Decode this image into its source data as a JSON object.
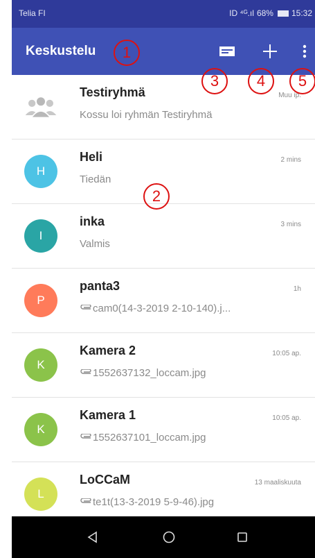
{
  "status_bar": {
    "carrier": "Telia FI",
    "signal_text": "ID ⁴ᴳ.ıl",
    "battery": "68%",
    "time": "15:32"
  },
  "app_bar": {
    "title": "Keskustelu",
    "actions": [
      "message-icon",
      "add-icon",
      "more-vert-icon"
    ]
  },
  "conversations": [
    {
      "name": "Testiryhmä",
      "preview": "Kossu loi ryhmän Testiryhmä",
      "time": "Muu ip.",
      "avatar_letter": "",
      "avatar_color": "#c8c8c8",
      "is_group": true,
      "attachment": false
    },
    {
      "name": "Heli",
      "preview": "Tiedän",
      "time": "2 mins",
      "avatar_letter": "H",
      "avatar_color": "#4dc3e5",
      "is_group": false,
      "attachment": false
    },
    {
      "name": "inka",
      "preview": "Valmis",
      "time": "3 mins",
      "avatar_letter": "I",
      "avatar_color": "#2aa5a5",
      "is_group": false,
      "attachment": false
    },
    {
      "name": "panta3",
      "preview": "cam0(14-3-2019 2-10-140).j...",
      "time": "1h",
      "avatar_letter": "P",
      "avatar_color": "#ff7b5a",
      "is_group": false,
      "attachment": true
    },
    {
      "name": "Kamera 2",
      "preview": "1552637132_loccam.jpg",
      "time": "10:05 ap.",
      "avatar_letter": "K",
      "avatar_color": "#8bc34a",
      "is_group": false,
      "attachment": true
    },
    {
      "name": "Kamera 1",
      "preview": "1552637101_loccam.jpg",
      "time": "10:05 ap.",
      "avatar_letter": "K",
      "avatar_color": "#8bc34a",
      "is_group": false,
      "attachment": true
    },
    {
      "name": "LoCCaM",
      "preview": "te1t(13-3-2019 5-9-46).jpg",
      "time": "13 maaliskuuta",
      "avatar_letter": "L",
      "avatar_color": "#d4e157",
      "is_group": false,
      "attachment": true
    }
  ],
  "nav_bar": {
    "buttons": [
      "back-triangle-icon",
      "home-circle-icon",
      "recents-square-icon"
    ]
  },
  "annotations": [
    "1",
    "2",
    "3",
    "4",
    "5"
  ],
  "colors": {
    "status_bar": "#2f3a9a",
    "app_bar": "#3f51b5",
    "callout": "#dd1111"
  }
}
